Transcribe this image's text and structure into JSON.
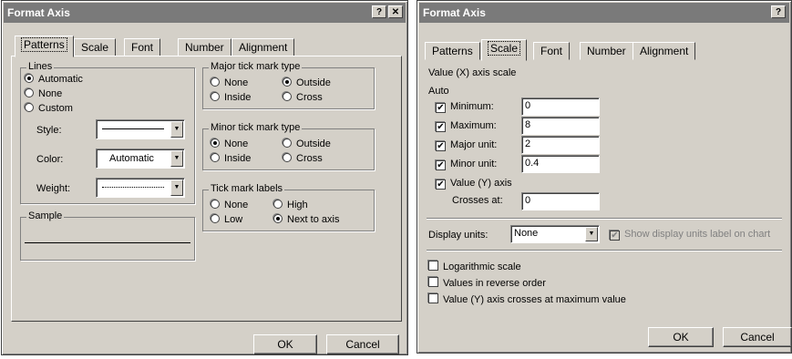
{
  "left": {
    "title": "Format Axis",
    "help": "?",
    "close": "✕",
    "tabs": [
      "Patterns",
      "Scale",
      "Font",
      "Number",
      "Alignment"
    ],
    "lines": {
      "legend": "Lines",
      "options": [
        "Automatic",
        "None",
        "Custom"
      ],
      "style_label": "Style:",
      "color_label": "Color:",
      "color_value": "Automatic",
      "weight_label": "Weight:"
    },
    "sample_legend": "Sample",
    "major": {
      "legend": "Major tick mark type",
      "opts": [
        "None",
        "Outside",
        "Inside",
        "Cross"
      ]
    },
    "minor": {
      "legend": "Minor tick mark type",
      "opts": [
        "None",
        "Outside",
        "Inside",
        "Cross"
      ]
    },
    "labels": {
      "legend": "Tick mark labels",
      "opts": [
        "None",
        "High",
        "Low",
        "Next to axis"
      ]
    },
    "ok": "OK",
    "cancel": "Cancel"
  },
  "right": {
    "title": "Format Axis",
    "help": "?",
    "close": "✕",
    "tabs": [
      "Patterns",
      "Scale",
      "Font",
      "Number",
      "Alignment"
    ],
    "heading": "Value (X) axis scale",
    "auto": "Auto",
    "rows": [
      {
        "label": "Minimum:",
        "value": "0"
      },
      {
        "label": "Maximum:",
        "value": "8"
      },
      {
        "label": "Major unit:",
        "value": "2"
      },
      {
        "label": "Minor unit:",
        "value": "0.4"
      }
    ],
    "value_axis": "Value (Y) axis",
    "crosses_label": "Crosses at:",
    "crosses_value": "0",
    "display_units_label": "Display units:",
    "display_units_value": "None",
    "show_units_label": "Show display units label on chart",
    "log_scale": "Logarithmic scale",
    "reverse": "Values in reverse order",
    "crosses_max": "Value (Y) axis crosses at maximum value",
    "ok": "OK",
    "cancel": "Cancel"
  }
}
